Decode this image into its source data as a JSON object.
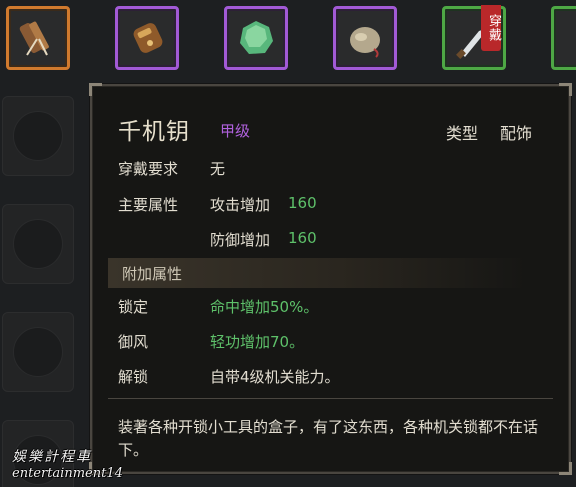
{
  "inventory": {
    "slots": [
      {
        "icon": "bundle-icon",
        "rarity": "orange",
        "color": "#d07a2e"
      },
      {
        "icon": "pouch-icon",
        "rarity": "purple",
        "color": "#a25ad6"
      },
      {
        "icon": "jade-stone-icon",
        "rarity": "purple",
        "color": "#a25ad6"
      },
      {
        "icon": "cloth-bag-icon",
        "rarity": "purple",
        "color": "#a25ad6"
      },
      {
        "icon": "blade-icon",
        "rarity": "green",
        "color": "#4ea845",
        "equipped_tag": "穿戴"
      },
      {
        "icon": "item-icon",
        "rarity": "green",
        "color": "#4ea845"
      }
    ]
  },
  "tooltip": {
    "name": "千机钥",
    "grade": "甲级",
    "type_label": "类型",
    "type_value": "配饰",
    "requirement_label": "穿戴要求",
    "requirement_value": "无",
    "main_attr_label": "主要属性",
    "main_attrs": [
      {
        "name": "攻击增加",
        "value": "160"
      },
      {
        "name": "防御增加",
        "value": "160"
      }
    ],
    "extra_section_title": "附加属性",
    "extra_attrs": [
      {
        "label": "锁定",
        "value": "命中增加50%。",
        "color": "#5ec16a"
      },
      {
        "label": "御风",
        "value": "轻功增加70。",
        "color": "#5ec16a"
      },
      {
        "label": "解锁",
        "value": "自带4级机关能力。",
        "color": "#e2ddd0"
      }
    ],
    "description": "装著各种开锁小工具的盒子，有了这东西，各种机关锁都不在话下。"
  },
  "watermark": {
    "line1": "娛樂計程車",
    "line2": "entertainment14"
  },
  "colors": {
    "grade": "#b061dd",
    "stat_green": "#5ec16a",
    "text": "#e2ddd0",
    "equip_tag": "#b9282a"
  }
}
